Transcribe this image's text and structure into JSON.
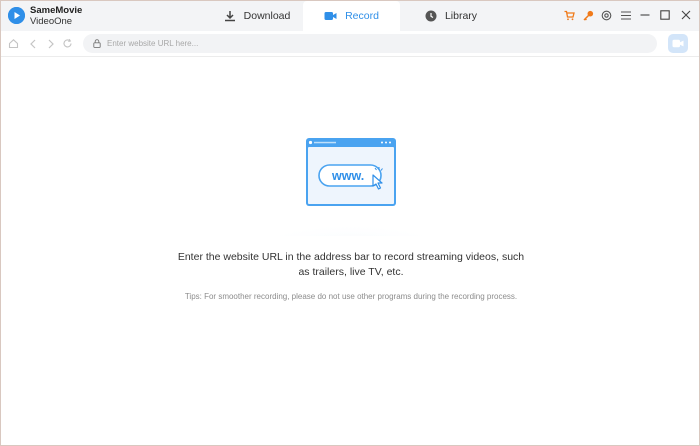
{
  "app": {
    "name": "SameMovie",
    "subname": "VideoOne",
    "accent": "#2f8fe8"
  },
  "tabs": [
    {
      "label": "Download",
      "icon": "download-icon",
      "active": false
    },
    {
      "label": "Record",
      "icon": "record-icon",
      "active": true
    },
    {
      "label": "Library",
      "icon": "clock-icon",
      "active": false
    }
  ],
  "window_controls": [
    "cart-icon",
    "key-icon",
    "settings-icon",
    "menu-icon",
    "minimize-icon",
    "maximize-icon",
    "close-icon"
  ],
  "toolbar": {
    "url_placeholder": "Enter website URL here...",
    "nav_icons": [
      "home-icon",
      "back-icon",
      "forward-icon",
      "refresh-icon"
    ]
  },
  "main": {
    "illustration_text": "www.",
    "message": "Enter the website URL in the address bar to record streaming videos, such as trailers, live TV, etc.",
    "tips": "Tips: For smoother recording, please do not use other programs during the recording process."
  }
}
